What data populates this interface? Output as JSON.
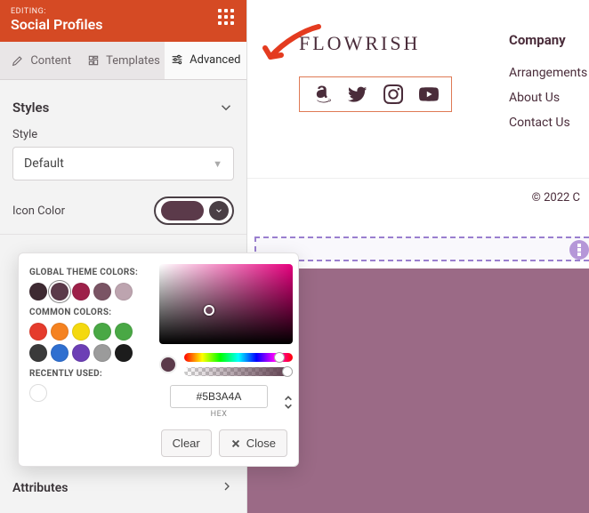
{
  "header": {
    "eyebrow": "EDITING:",
    "title": "Social Profiles"
  },
  "tabs": {
    "content": "Content",
    "templates": "Templates",
    "advanced": "Advanced"
  },
  "styles": {
    "heading": "Styles",
    "style_label": "Style",
    "style_value": "Default",
    "icon_color_label": "Icon Color"
  },
  "attributes": {
    "heading": "Attributes"
  },
  "picker": {
    "global_label": "GLOBAL THEME COLORS:",
    "common_label": "COMMON COLORS:",
    "recent_label": "RECENTLY USED:",
    "hex_value": "#5B3A4A",
    "hex_label": "HEX",
    "clear": "Clear",
    "close": "Close",
    "global_colors": [
      "#3e2a32",
      "#5b3a4a",
      "#9d2049",
      "#7a5464",
      "#bda4af"
    ],
    "common_colors": [
      "#e53b2c",
      "#f58220",
      "#f4d90f",
      "#49a845",
      "#49a845",
      "#3a3a3a",
      "#2f6fd0",
      "#6c3fb5",
      "#9b9b9b",
      "#1c1c1c"
    ]
  },
  "preview": {
    "brand": "FLOWRISH",
    "company_heading": "Company",
    "links": [
      "Arrangements",
      "About Us",
      "Contact Us"
    ],
    "copyright": "© 2022 C"
  }
}
